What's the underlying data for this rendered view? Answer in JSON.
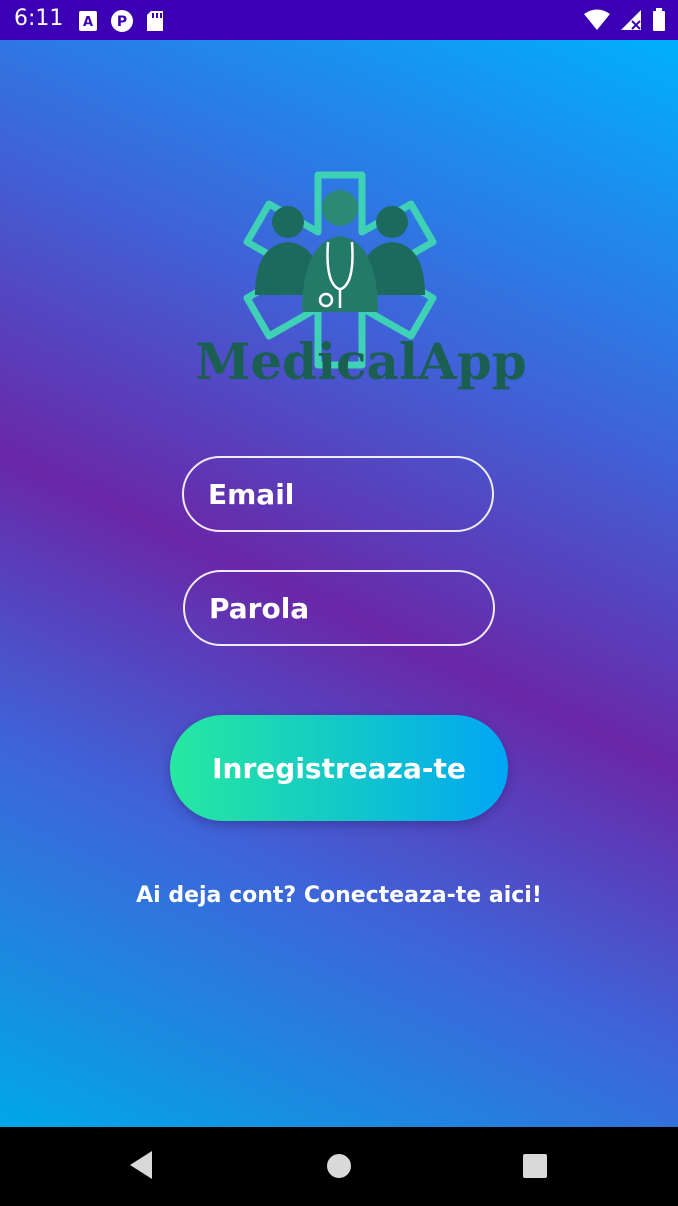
{
  "status_bar": {
    "time": "6:11",
    "left_icons": [
      "text-a-icon",
      "p-badge-icon",
      "sd-card-icon"
    ],
    "right_icons": [
      "wifi-icon",
      "signal-off-icon",
      "battery-icon"
    ],
    "background": "#3b00b3"
  },
  "logo": {
    "text": "MedicalApp",
    "color": "#1b5e52",
    "star_color": "#3fd1b5"
  },
  "form": {
    "email_placeholder": "Email",
    "password_placeholder": "Parola"
  },
  "register_button": {
    "label": "Inregistreaza-te"
  },
  "login_link": {
    "text": "Ai deja cont? Conecteaza-te aici!"
  },
  "nav_bar": {
    "icons": [
      "back-icon",
      "home-icon",
      "recents-icon"
    ]
  },
  "colors": {
    "gradient_blue": "#00b0ff",
    "gradient_purple": "#6a27a8",
    "button_green": "#27e8a0",
    "button_blue": "#00a6f5"
  }
}
